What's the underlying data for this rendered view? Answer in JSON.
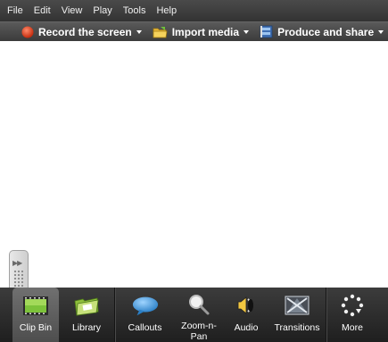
{
  "menu": {
    "items": [
      "File",
      "Edit",
      "View",
      "Play",
      "Tools",
      "Help"
    ]
  },
  "toolbar": {
    "record_label": "Record the screen",
    "import_label": "Import media",
    "produce_label": "Produce and share",
    "overflow_glyph": "»"
  },
  "tabs": {
    "clip_bin": "Clip Bin",
    "library": "Library",
    "callouts": "Callouts",
    "zoom_n_pan": "Zoom-n-Pan",
    "audio": "Audio",
    "transitions": "Transitions",
    "more": "More"
  },
  "colors": {
    "record_icon": "#d93a1a",
    "callouts_icon": "#3b9ad9",
    "clip_bin_icon": "#5fa82a"
  }
}
